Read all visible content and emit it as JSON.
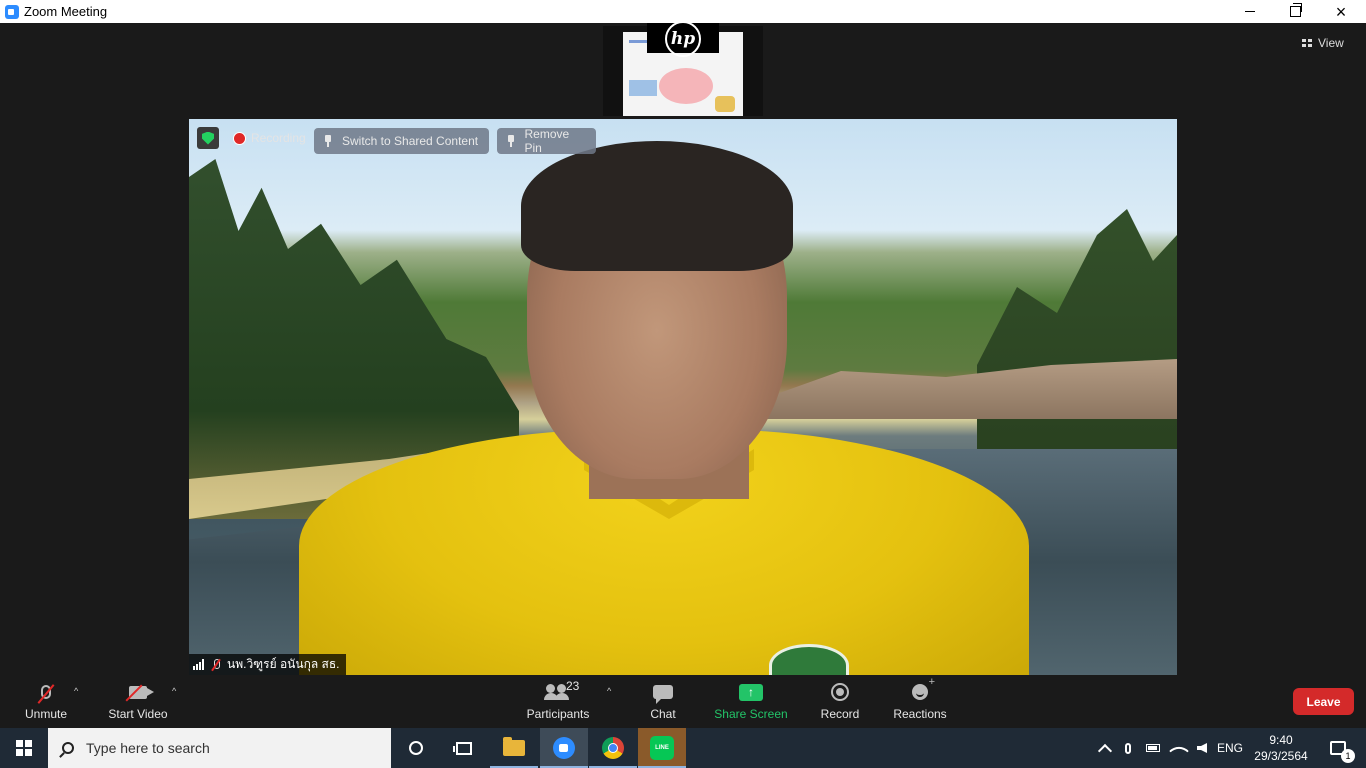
{
  "window": {
    "title": "Zoom Meeting",
    "controls": {
      "minimize": "minimize",
      "maximize": "restore",
      "close": "×"
    }
  },
  "top_right": {
    "view_label": "View"
  },
  "video": {
    "recording_label": "Recording",
    "switch_label": "Switch to Shared Content",
    "remove_pin_label": "Remove Pin",
    "participant_name": "นพ.วิฑูรย์ อนันกุล สธ."
  },
  "toolbar": {
    "unmute_label": "Unmute",
    "start_video_label": "Start Video",
    "participants_label": "Participants",
    "participants_count": "23",
    "chat_label": "Chat",
    "share_label": "Share Screen",
    "record_label": "Record",
    "reactions_label": "Reactions",
    "leave_label": "Leave",
    "caret": "^",
    "share_glyph": "↑"
  },
  "taskbar": {
    "search_placeholder": "Type here to search",
    "line_label": "LINE",
    "language": "ENG",
    "time": "9:40",
    "date": "29/3/2564",
    "notification_count": "1"
  },
  "colors": {
    "leave": "#d42a2a",
    "share": "#23c468",
    "zoom_blue": "#2d8cff",
    "shield": "#23d160"
  }
}
